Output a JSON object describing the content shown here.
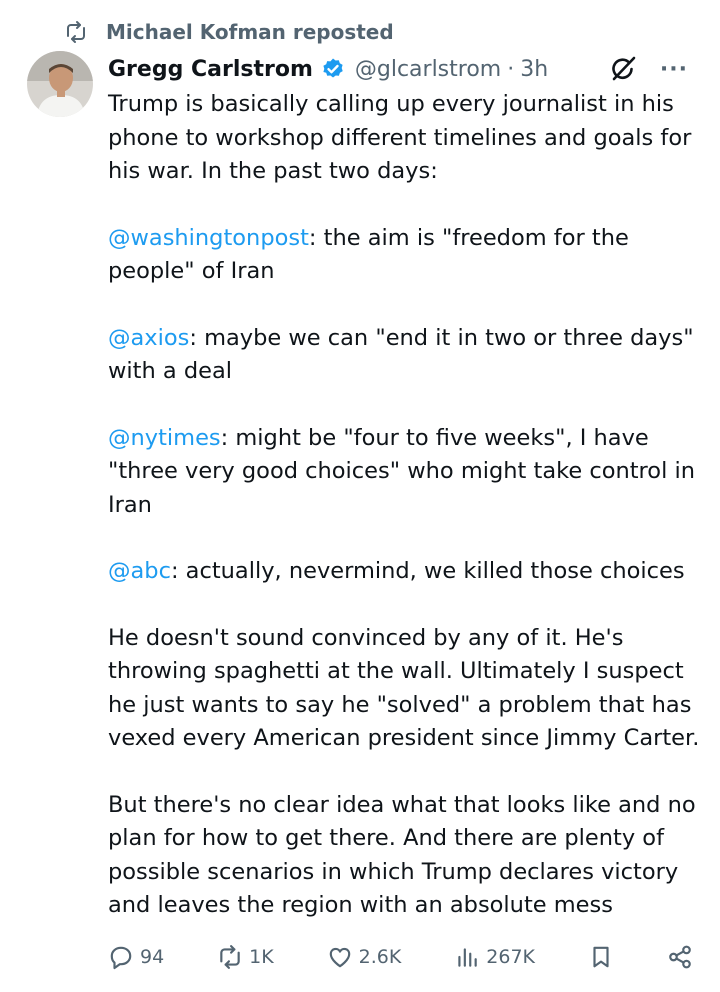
{
  "repost": {
    "icon": "repost-icon",
    "text": "Michael Kofman reposted"
  },
  "author": {
    "avatar": "avatar",
    "name": "Gregg Carlstrom",
    "verified_icon": "verified-badge-icon",
    "handle": "@glcarlstrom",
    "separator": "·",
    "time": "3h"
  },
  "header_icons": [
    "grok-icon",
    "more-icon"
  ],
  "more_label": "···",
  "post": {
    "p1": "Trump is basically calling up every journalist in his phone to workshop different timelines and goals for his war. In the past two days:",
    "p2_mention": "@washingtonpost",
    "p2_text": ": the aim is \"freedom for the people\" of Iran",
    "p3_mention": "@axios",
    "p3_text": ": maybe we can \"end it in two or three days\" with a deal",
    "p4_mention": "@nytimes",
    "p4_text": ": might be \"four to five weeks\", I have \"three very good choices\" who might take control in Iran",
    "p5_mention": "@abc",
    "p5_text": ": actually, nevermind, we killed those choices",
    "p6": "He doesn't sound convinced by any of it. He's throwing spaghetti at the wall. Ultimately I suspect he just wants to say he \"solved\" a problem that has vexed every American president since Jimmy Carter.",
    "p7": "But there's no clear idea what that looks like and no plan for how to get there. And there are plenty of possible scenarios in which Trump declares victory and leaves the region with an absolute mess"
  },
  "actions": {
    "replies": "94",
    "reposts": "1K",
    "likes": "2.6K",
    "views": "267K"
  },
  "colors": {
    "accent": "#1d9bf0",
    "muted": "#536471",
    "text": "#0f1419"
  }
}
